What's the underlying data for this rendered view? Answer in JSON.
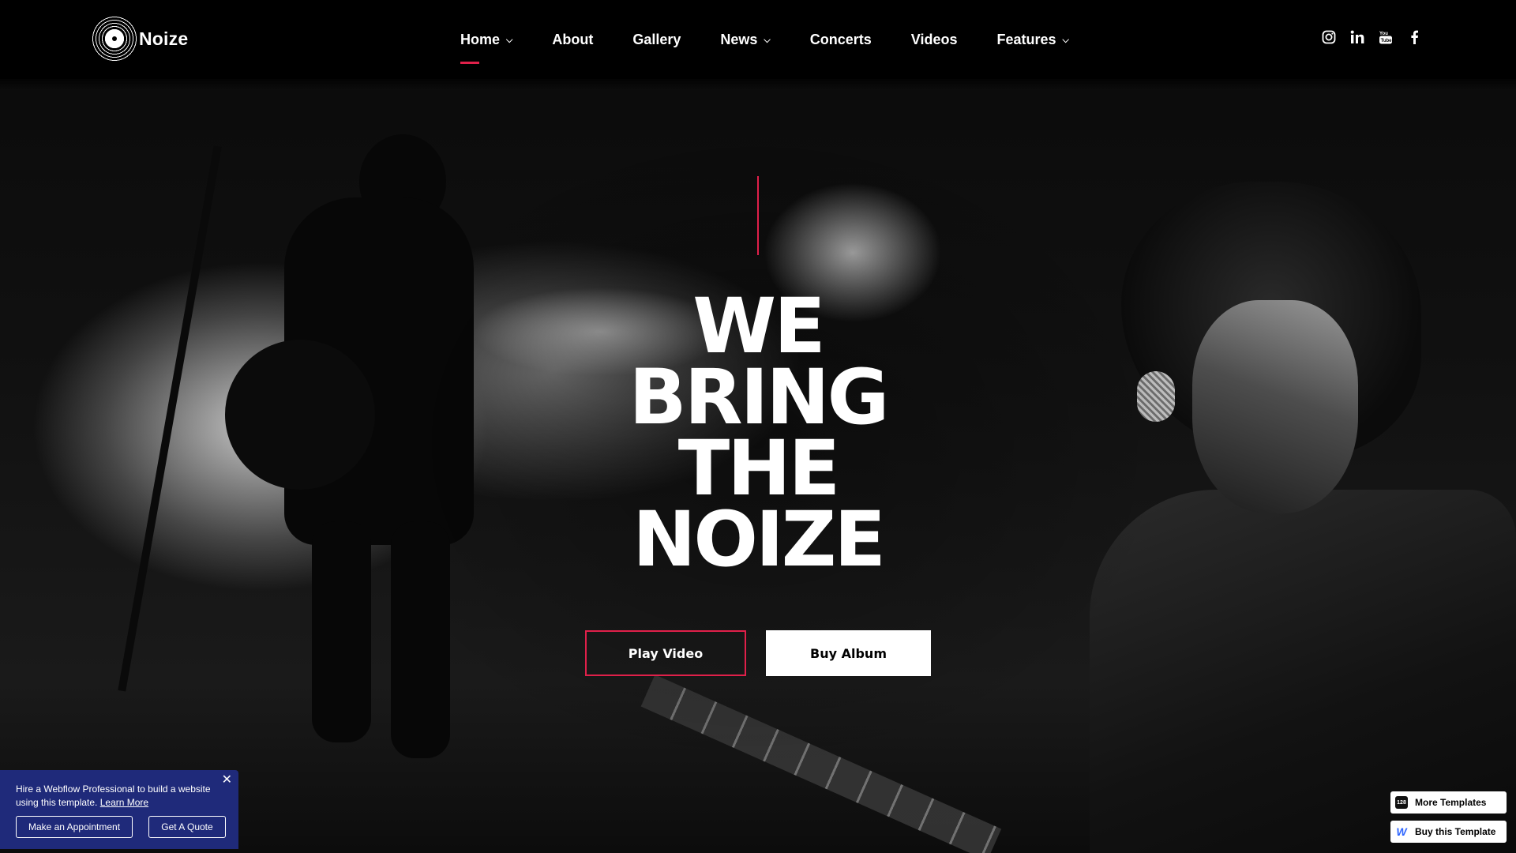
{
  "brand": {
    "name": "Noize"
  },
  "nav": {
    "items": [
      {
        "label": "Home",
        "has_dropdown": true,
        "active": true
      },
      {
        "label": "About",
        "has_dropdown": false
      },
      {
        "label": "Gallery",
        "has_dropdown": false
      },
      {
        "label": "News",
        "has_dropdown": true
      },
      {
        "label": "Concerts",
        "has_dropdown": false
      },
      {
        "label": "Videos",
        "has_dropdown": false
      },
      {
        "label": "Features",
        "has_dropdown": true
      }
    ]
  },
  "social": {
    "icons": [
      "instagram-icon",
      "linkedin-icon",
      "youtube-icon",
      "facebook-icon"
    ]
  },
  "hero": {
    "headline_lines": [
      "WE",
      "BRING",
      "THE",
      "NOIZE"
    ],
    "primary_button": "Play Video",
    "secondary_button": "Buy Album"
  },
  "hire_banner": {
    "text": "Hire a Webflow Professional to build a website using this template.",
    "link": "Learn More",
    "button_appointment": "Make an Appointment",
    "button_quote": "Get A Quote",
    "close_symbol": "✕"
  },
  "template_badges": {
    "more": "More Templates",
    "more_icon_text": "128",
    "buy": "Buy this Template",
    "buy_icon_text": "W"
  },
  "colors": {
    "accent": "#e0204a",
    "banner": "#1f2a7a",
    "nav_bg": "#000000"
  }
}
